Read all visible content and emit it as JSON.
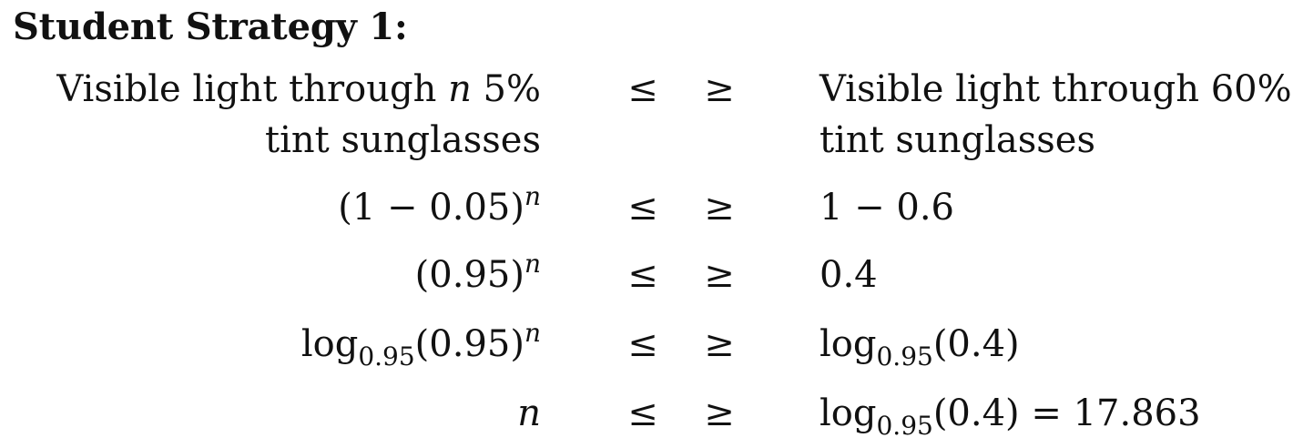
{
  "heading": "Student Strategy 1:",
  "symbols": {
    "le": "≤",
    "ge": "≥"
  },
  "rows": [
    {
      "lhs_line1_prefix": "Visible light through ",
      "lhs_line1_var": "n",
      "lhs_line1_suffix": " 5%",
      "lhs_line2": "tint sunglasses",
      "rhs_line1": "Visible light through 60%",
      "rhs_line2": "tint sunglasses"
    },
    {
      "lhs": "(1 − 0.05)",
      "lhs_sup": "n",
      "rhs": "1 − 0.6"
    },
    {
      "lhs": "(0.95)",
      "lhs_sup": "n",
      "rhs": "0.4"
    },
    {
      "lhs_log": "log",
      "lhs_sub": "0.95",
      "lhs_arg": "(0.95)",
      "lhs_sup": "n",
      "rhs_log": "log",
      "rhs_sub": "0.95",
      "rhs_arg": "(0.4)"
    },
    {
      "lhs_var": "n",
      "rhs_log": "log",
      "rhs_sub": "0.95",
      "rhs_arg": "(0.4)",
      "rhs_equals": " = 17.863"
    }
  ]
}
